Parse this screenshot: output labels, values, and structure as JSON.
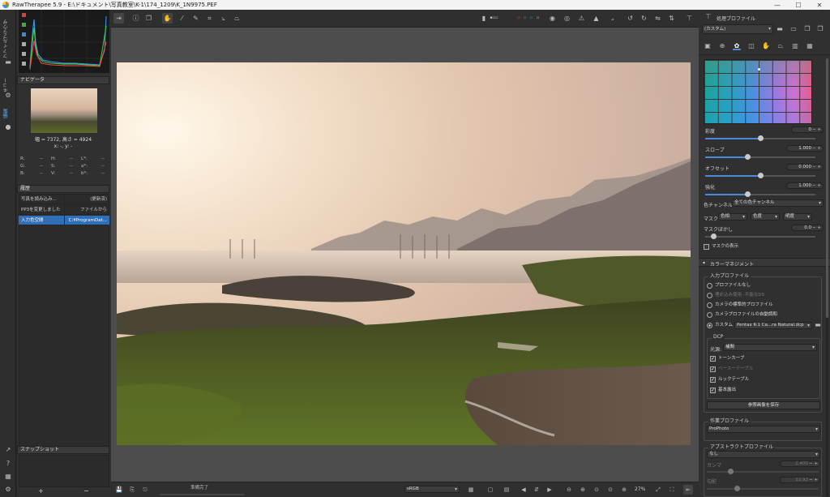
{
  "titlebar": {
    "title": "RawTherapee 5.9 - E:\\ドキュメント\\写真教室\\K-1\\174_1209\\K_1N9975.PEF"
  },
  "leftstrip": {
    "tabs": [
      "ファイルブラウザ",
      "キュー",
      "編集"
    ]
  },
  "navigator": {
    "header": "ナビゲータ",
    "size_text": "幅 = 7372, 高さ = 4924",
    "coords_text": "x: -, y: -",
    "rgb_labels": [
      "R:",
      "G:",
      "B:"
    ],
    "hsv_labels": [
      "H:",
      "S:",
      "V:"
    ],
    "lab_labels": [
      "L*:",
      "a*:",
      "b*:"
    ],
    "dash": "--"
  },
  "history": {
    "header": "履歴",
    "rows": [
      {
        "name": "写真を読み込み...",
        "value": "(更新済)"
      },
      {
        "name": "PP3を変更しました",
        "value": "ファイルから"
      },
      {
        "name": "入力色空間",
        "value": "C:¥ProgramDat..."
      }
    ]
  },
  "snapshot": {
    "header": "スナップショット",
    "add": "+",
    "remove": "−"
  },
  "bottombar": {
    "status": "準備完了",
    "zoom": "27%"
  },
  "rightpanel": {
    "profile_header": "処理プロファイル",
    "profile_value": "(カスタム)",
    "labels": {
      "saturation": "彩度",
      "saturation_val": "0",
      "slope": "スロープ",
      "slope_val": "1.000",
      "offset": "オフセット",
      "offset_val": "0.000",
      "power": "強化",
      "power_val": "1.000",
      "channel": "色チャンネル:",
      "channel_val": "全ての色チャンネル",
      "mask": "マスク:",
      "mask_hue": "色相",
      "mask_chroma": "色度",
      "mask_lum": "明度",
      "mask_blur": "マスクぼかし",
      "mask_blur_val": "0.0",
      "show_mask": "マスクの表示"
    },
    "color_mgmt": {
      "header": "カラーマネジメント",
      "input_profile": "入力プロファイル",
      "options": [
        "プロファイルなし",
        "埋め込み使用 -不能なDS",
        "カメラの標準的プロファイル",
        "カメラプロファイルの自動調和",
        "カスタム"
      ],
      "custom_file": "Pentax K-1 Ca...ra Natural.dcp",
      "dcp": "DCP",
      "illuminant": "光源:",
      "illuminant_val": "補間",
      "checks": [
        "トーンカーブ",
        "ベースーテーブル",
        "ルックテーブル",
        "基本露出"
      ],
      "save_ref": "参照画像を保存",
      "working_profile": "作業プロファイル",
      "working_val": "ProPhoto",
      "abstract_profile": "アブストラクトプロファイル",
      "abstract_val": "なし",
      "gamma": "ガンマ",
      "gamma_val": "2.400",
      "slope2": "勾配",
      "slope2_val": "12.92"
    }
  }
}
